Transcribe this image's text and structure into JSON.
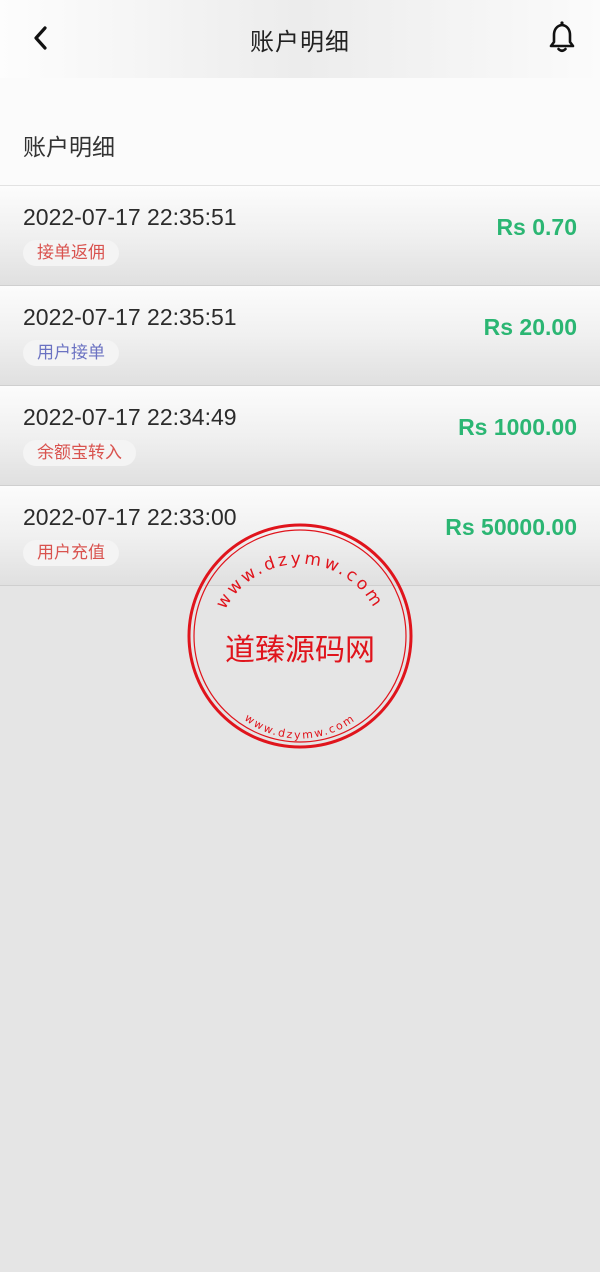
{
  "header": {
    "title": "账户明细",
    "back_icon": "chevron-left-icon",
    "bell_icon": "bell-icon"
  },
  "section": {
    "label": "账户明细"
  },
  "transactions": [
    {
      "time": "2022-07-17 22:35:51",
      "tag": "接单返佣",
      "tag_color": "#d9534f",
      "amount": "Rs 0.70"
    },
    {
      "time": "2022-07-17 22:35:51",
      "tag": "用户接单",
      "tag_color": "#6b72c2",
      "amount": "Rs 20.00"
    },
    {
      "time": "2022-07-17 22:34:49",
      "tag": "余额宝转入",
      "tag_color": "#d9534f",
      "amount": "Rs 1000.00"
    },
    {
      "time": "2022-07-17 22:33:00",
      "tag": "用户充值",
      "tag_color": "#d9534f",
      "amount": "Rs 50000.00"
    }
  ],
  "watermark": {
    "name": "道臻源码网",
    "top_text": "www.dzymw.com",
    "bottom_text": "www.dzymw.com",
    "color": "#e0141c"
  },
  "colors": {
    "amount": "#2bb673",
    "background": "#e5e5e5"
  }
}
